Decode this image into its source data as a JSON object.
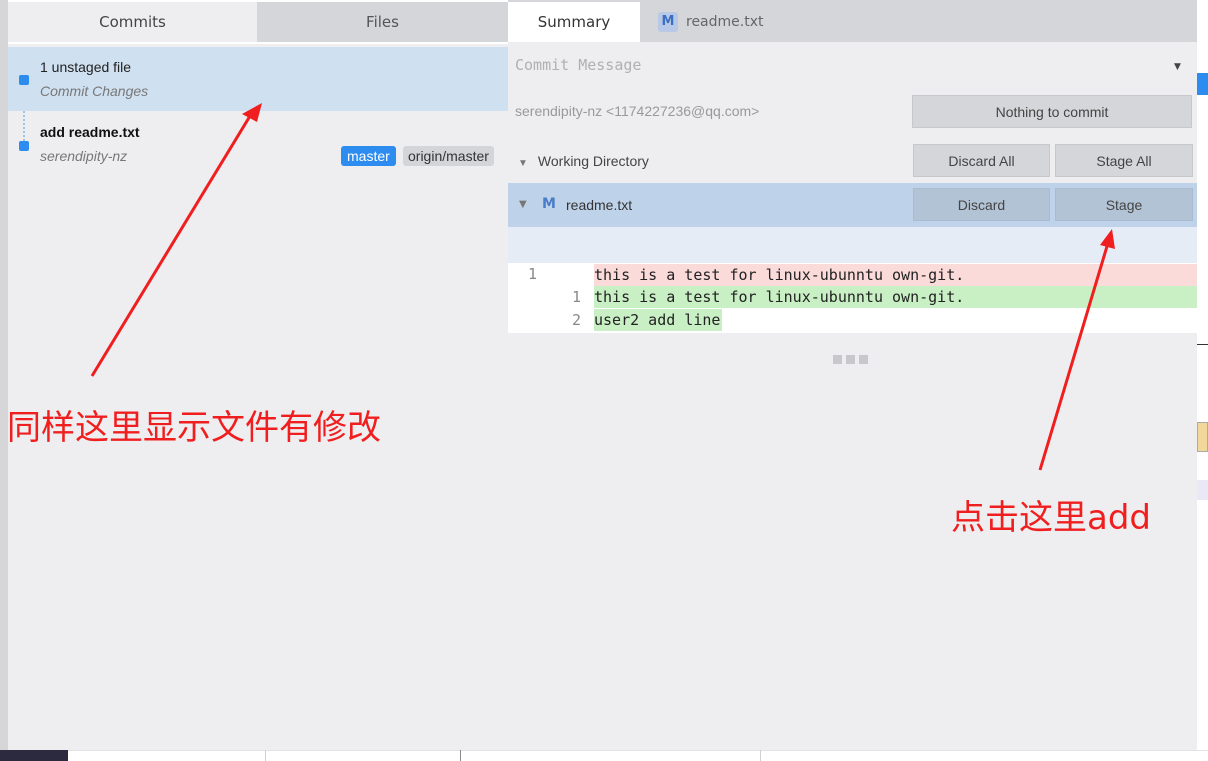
{
  "left_tabs": {
    "commits": "Commits",
    "files": "Files"
  },
  "unstaged": {
    "title": "1 unstaged file",
    "subtitle": "Commit Changes"
  },
  "commit": {
    "title": "add readme.txt",
    "author": "serendipity-nz",
    "branch_local": "master",
    "branch_remote": "origin/master"
  },
  "right_tabs": {
    "summary": "Summary",
    "file_badge": "M",
    "file_name": "readme.txt"
  },
  "summary": {
    "commit_placeholder": "Commit Message",
    "author": "serendipity-nz <1174227236@qq.com>",
    "nothing_button": "Nothing to commit",
    "working_directory": "Working Directory",
    "discard_all": "Discard All",
    "stage_all": "Stage All"
  },
  "file_row": {
    "status": "M",
    "name": "readme.txt",
    "discard": "Discard",
    "stage": "Stage"
  },
  "diff": {
    "lines": [
      {
        "old": "1",
        "new": "",
        "text": "this is a test for linux-ubunntu own-git."
      },
      {
        "old": "",
        "new": "1",
        "text": "this is a test for linux-ubunntu own-git."
      },
      {
        "old": "",
        "new": "2",
        "text": "user2 add line"
      }
    ]
  },
  "annotations": {
    "left": "同样这里显示文件有修改",
    "right": "点击这里add",
    "color": "#f01e1e"
  },
  "colors": {
    "accent": "#2d8cf0",
    "selected_row": "#cfe0f0",
    "file_row": "#bed3ea",
    "deleted": "#fbdada",
    "added": "#c9f0c4"
  },
  "icons": {
    "expand": "triangle-down-icon",
    "dropdown": "caret-down-icon",
    "diff_more": "ellipsis-icon"
  }
}
